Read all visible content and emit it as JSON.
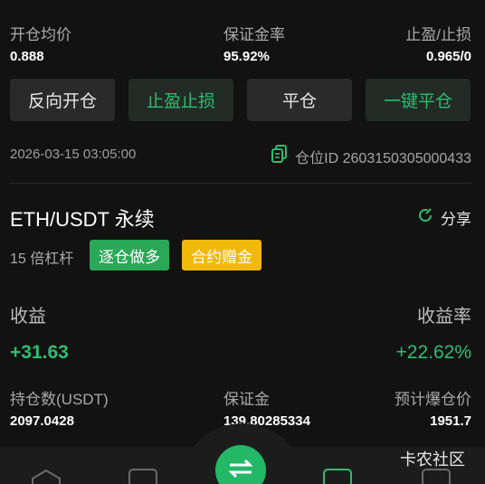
{
  "top_row": {
    "open_price_label": "开仓均价",
    "open_price_value": "0.888",
    "margin_rate_label": "保证金率",
    "margin_rate_value": "95.92%",
    "tp_sl_label": "止盈/止损",
    "tp_sl_value": "0.965/0"
  },
  "actions": {
    "reverse_label": "反向开仓",
    "tp_sl_label": "止盈止损",
    "close_label": "平仓",
    "close_all_label": "一键平仓"
  },
  "position_meta": {
    "datetime": "2026-03-15 03:05:00",
    "position_id": "仓位ID 2603150305000433"
  },
  "position": {
    "pair": "ETH/USDT 永续",
    "share_label": "分享",
    "leverage": "15 倍杠杆",
    "mode_tag": "逐仓做多",
    "bonus_tag": "合约赠金",
    "pnl_label": "收益",
    "pnl_value": "+31.63",
    "roi_label": "收益率",
    "roi_value": "+22.62%",
    "size_label": "持仓数(USDT)",
    "size_value": "2097.0428",
    "margin_label": "保证金",
    "margin_value": "139.80285334",
    "liq_label": "预计爆仓价",
    "liq_value": "1951.7"
  },
  "watermark": "卡农社区",
  "colors": {
    "accent_green": "#2ebd6f",
    "tag_green": "#2aa757",
    "tag_yellow": "#f0b90b",
    "background": "#121212"
  }
}
